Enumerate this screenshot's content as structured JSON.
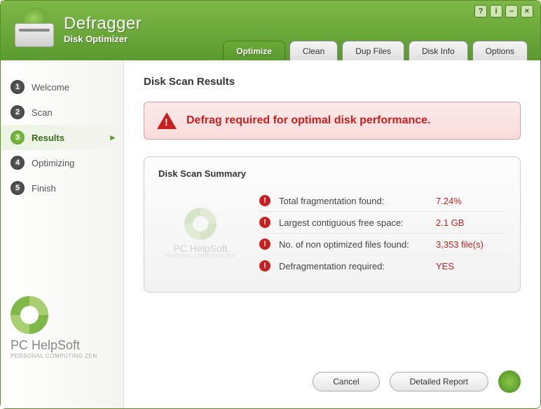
{
  "app": {
    "title": "Defragger",
    "subtitle": "Disk Optimizer"
  },
  "tabs": [
    {
      "label": "Optimize",
      "active": true
    },
    {
      "label": "Clean"
    },
    {
      "label": "Dup Files"
    },
    {
      "label": "Disk Info"
    },
    {
      "label": "Options"
    }
  ],
  "steps": [
    {
      "num": "1",
      "label": "Welcome"
    },
    {
      "num": "2",
      "label": "Scan"
    },
    {
      "num": "3",
      "label": "Results",
      "active": true
    },
    {
      "num": "4",
      "label": "Optimizing"
    },
    {
      "num": "5",
      "label": "Finish"
    }
  ],
  "brand": {
    "name": "PC HelpSoft",
    "tagline": "PERSONAL COMPUTING ZEN"
  },
  "page": {
    "title": "Disk Scan Results",
    "alert": "Defrag required for optimal disk performance.",
    "summary_title": "Disk Scan Summary",
    "rows": [
      {
        "label": "Total fragmentation found:",
        "value": "7.24%"
      },
      {
        "label": "Largest contiguous free space:",
        "value": "2.1 GB"
      },
      {
        "label": "No. of non optimized files found:",
        "value": "3,353 file(s)"
      },
      {
        "label": "Defragmentation required:",
        "value": "YES"
      }
    ]
  },
  "buttons": {
    "cancel": "Cancel",
    "report": "Detailed Report"
  }
}
